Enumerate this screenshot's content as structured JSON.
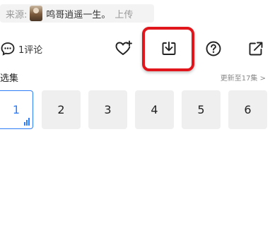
{
  "source": {
    "label": "来源:",
    "uploader": "鸣哥逍遥一生。",
    "suffix": "上传"
  },
  "actions": {
    "comment_label": "1评论",
    "favorite_icon": "heart-plus-icon",
    "download_icon": "download-icon",
    "help_icon": "question-icon",
    "share_icon": "share-icon"
  },
  "episodes": {
    "title": "选集",
    "more": "更新至17集 >",
    "items": [
      "1",
      "2",
      "3",
      "4",
      "5",
      "6"
    ],
    "active_index": 0
  },
  "colors": {
    "accent": "#2f7df6",
    "highlight": "#e0161c"
  }
}
